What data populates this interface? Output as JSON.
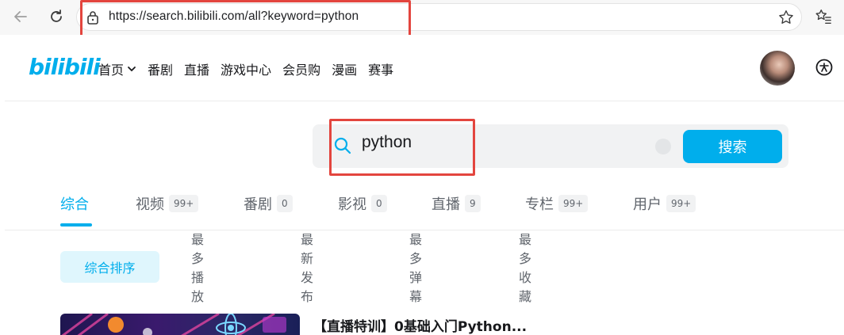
{
  "browser": {
    "url": "https://search.bilibili.com/all?keyword=python"
  },
  "header": {
    "logo": "bilibili",
    "nav": [
      {
        "label": "首页",
        "has_dropdown": true
      },
      {
        "label": "番剧"
      },
      {
        "label": "直播"
      },
      {
        "label": "游戏中心"
      },
      {
        "label": "会员购"
      },
      {
        "label": "漫画"
      },
      {
        "label": "赛事"
      }
    ]
  },
  "search": {
    "value": "python",
    "button_label": "搜索"
  },
  "tabs": [
    {
      "label": "综合",
      "badge": "",
      "active": true
    },
    {
      "label": "视频",
      "badge": "99+"
    },
    {
      "label": "番剧",
      "badge": "0"
    },
    {
      "label": "影视",
      "badge": "0"
    },
    {
      "label": "直播",
      "badge": "9"
    },
    {
      "label": "专栏",
      "badge": "99+"
    },
    {
      "label": "用户",
      "badge": "99+"
    }
  ],
  "sorts": [
    {
      "label": "综合排序",
      "active": true
    },
    {
      "label": "最多播放"
    },
    {
      "label": "最新发布"
    },
    {
      "label": "最多弹幕"
    },
    {
      "label": "最多收藏"
    }
  ],
  "results": [
    {
      "title": "【直播特训】0基础入门Python..."
    }
  ],
  "colors": {
    "accent": "#00aeec",
    "highlight": "#e3453e"
  }
}
